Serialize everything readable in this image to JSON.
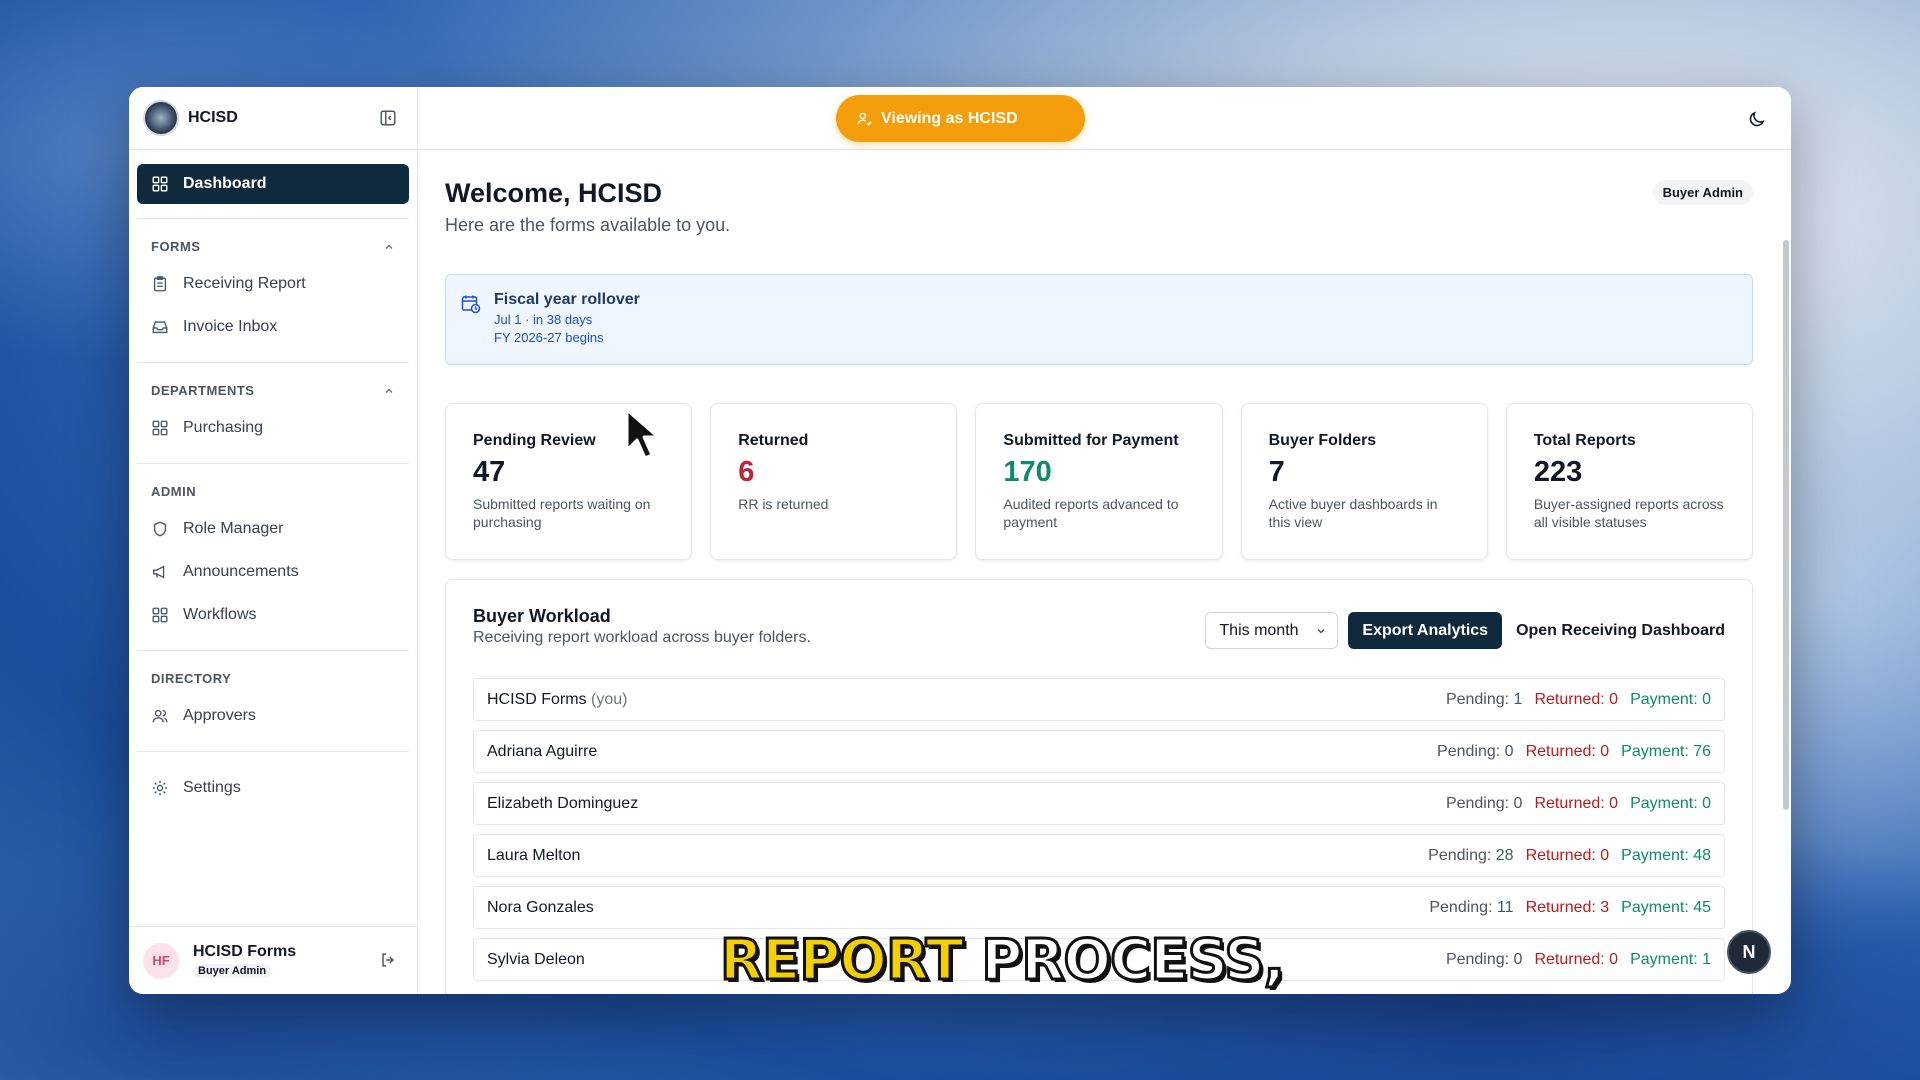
{
  "brand": {
    "name": "HCISD"
  },
  "sidebar": {
    "dashboard": "Dashboard",
    "sections": {
      "forms": {
        "title": "FORMS",
        "items": [
          "Receiving Report",
          "Invoice Inbox"
        ]
      },
      "departments": {
        "title": "DEPARTMENTS",
        "items": [
          "Purchasing"
        ]
      },
      "admin": {
        "title": "ADMIN",
        "items": [
          "Role Manager",
          "Announcements",
          "Workflows"
        ]
      },
      "directory": {
        "title": "DIRECTORY",
        "items": [
          "Approvers"
        ]
      }
    },
    "settings": "Settings",
    "user": {
      "initials": "HF",
      "name": "HCISD Forms",
      "role": "Buyer Admin"
    }
  },
  "topbar": {
    "viewing": "Viewing as HCISD"
  },
  "header": {
    "title": "Welcome, HCISD",
    "subtitle": "Here are the forms available to you.",
    "role_badge": "Buyer Admin"
  },
  "fiscal": {
    "title": "Fiscal year rollover",
    "line1": "Jul 1 · in 38 days",
    "line2": "FY 2026-27 begins"
  },
  "stats": [
    {
      "label": "Pending Review",
      "value": "47",
      "desc": "Submitted reports waiting on purchasing",
      "color": "#111827"
    },
    {
      "label": "Returned",
      "value": "6",
      "desc": "RR is returned",
      "color": "#c0213a"
    },
    {
      "label": "Submitted for Payment",
      "value": "170",
      "desc": "Audited reports advanced to payment",
      "color": "#0f8a6a"
    },
    {
      "label": "Buyer Folders",
      "value": "7",
      "desc": "Active buyer dashboards in this view",
      "color": "#111827"
    },
    {
      "label": "Total Reports",
      "value": "223",
      "desc": "Buyer-assigned reports across all visible statuses",
      "color": "#111827"
    }
  ],
  "workload": {
    "title": "Buyer Workload",
    "subtitle": "Receiving report workload across buyer folders.",
    "period": "This month",
    "export_label": "Export Analytics",
    "open_label": "Open Receiving Dashboard",
    "rows": [
      {
        "name": "HCISD Forms",
        "suffix": "(you)",
        "pending": "Pending: 1",
        "returned": "Returned: 0",
        "payment": "Payment: 0"
      },
      {
        "name": "Adriana Aguirre",
        "suffix": "",
        "pending": "Pending: 0",
        "returned": "Returned: 0",
        "payment": "Payment: 76"
      },
      {
        "name": "Elizabeth Dominguez",
        "suffix": "",
        "pending": "Pending: 0",
        "returned": "Returned: 0",
        "payment": "Payment: 0"
      },
      {
        "name": "Laura Melton",
        "suffix": "",
        "pending": "Pending: 28",
        "returned": "Returned: 0",
        "payment": "Payment: 48"
      },
      {
        "name": "Nora Gonzales",
        "suffix": "",
        "pending": "Pending: 11",
        "returned": "Returned: 3",
        "payment": "Payment: 45"
      },
      {
        "name": "Sylvia Deleon",
        "suffix": "",
        "pending": "Pending: 0",
        "returned": "Returned: 0",
        "payment": "Payment: 1"
      }
    ]
  },
  "overlay": {
    "caption_word1": "REPORT",
    "caption_word2": "PROCESS,",
    "badge": "N"
  }
}
